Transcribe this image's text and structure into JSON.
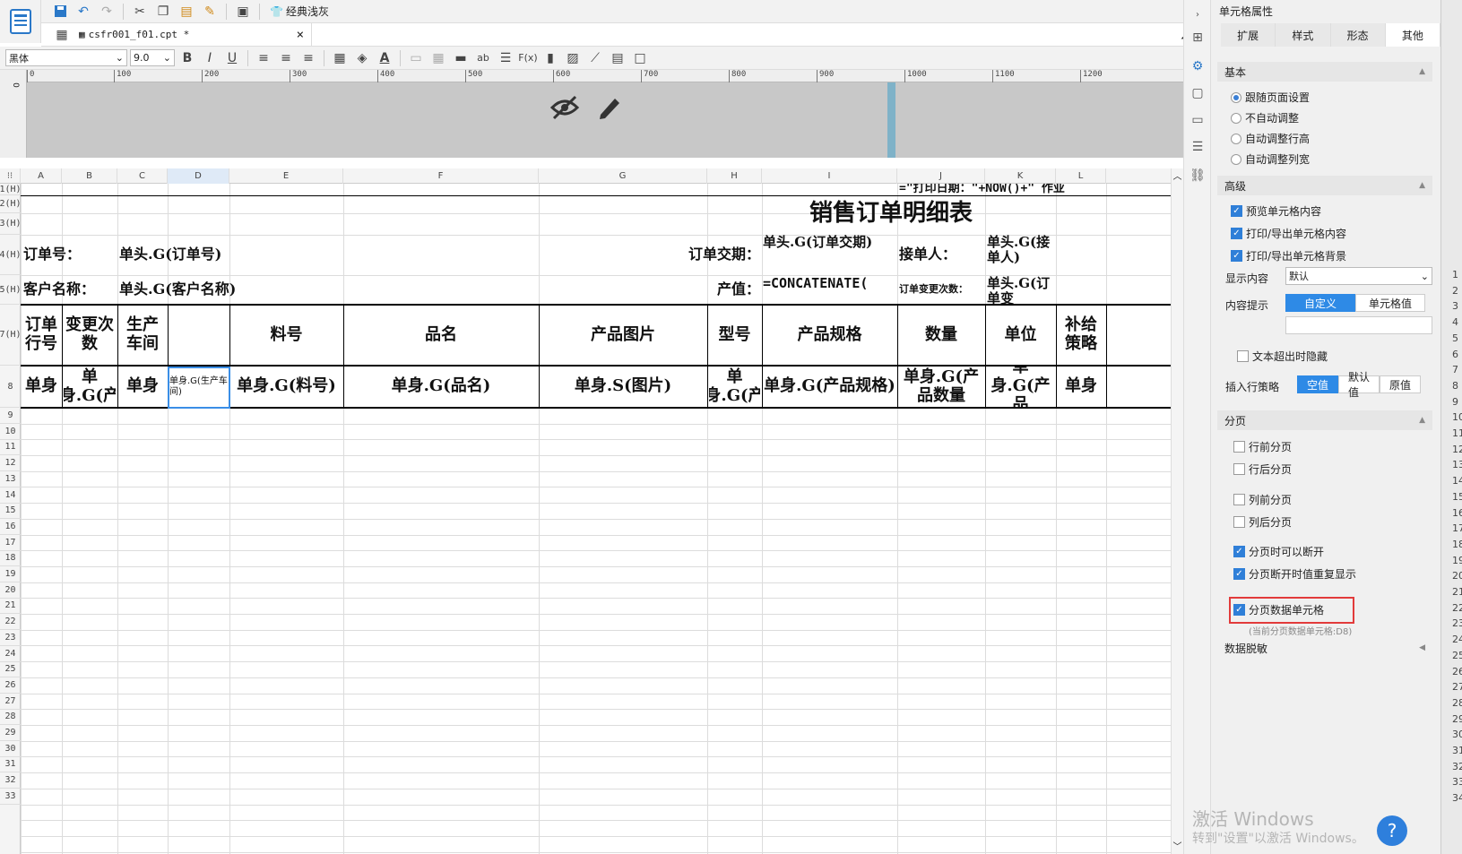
{
  "toolbar": {
    "classic_label": "经典浅灰"
  },
  "tab": {
    "file_name": "csfr001_f01.cpt *",
    "close": "×"
  },
  "format": {
    "font_name": "黑体",
    "font_size": "9.0",
    "bold": "B",
    "italic": "I",
    "underline": "U",
    "ab": "ab",
    "fx": "F(x)"
  },
  "ruler": {
    "ticks": [
      "100",
      "200",
      "300",
      "400",
      "500",
      "600",
      "700",
      "800",
      "900",
      "1000",
      "1100",
      "1200"
    ]
  },
  "columns": [
    "A",
    "B",
    "C",
    "D",
    "E",
    "F",
    "G",
    "H",
    "I",
    "J",
    "K",
    "L"
  ],
  "rows": [
    "1(H)",
    "2(H)",
    "3(H)",
    "4(H)",
    "5(H)",
    "7(H)",
    "8",
    "9",
    "10",
    "11",
    "12",
    "13",
    "14",
    "15",
    "16",
    "17",
    "18",
    "19",
    "20",
    "21",
    "22",
    "23",
    "24",
    "25",
    "26",
    "27",
    "28",
    "29",
    "30",
    "31",
    "32",
    "33"
  ],
  "sheet": {
    "r1": "=\"打印日期：\"+NOW()+\"  作业",
    "title": "销售订单明细表",
    "order_no_label": "订单号：",
    "order_no_val": "单头.G(订单号)",
    "deliv_label": "订单交期：",
    "deliv_val": "单头.G(订单交期)",
    "receiver_label": "接单人：",
    "receiver_val": "单头.G(接单人)",
    "cust_label": "客户名称：",
    "cust_val": "单头.G(客户名称)",
    "value_label": "产值：",
    "value_val": "=CONCATENATE(",
    "change_label": "订单变更次数：",
    "change_val": "单头.G(订单变",
    "headers": [
      "订单行号",
      "变更次数",
      "生产车间",
      "",
      "料号",
      "品名",
      "产品图片",
      "型号",
      "产品规格",
      "数量",
      "单位",
      "补给策略"
    ],
    "row8": [
      "单身",
      "单身.G(产",
      "单身",
      "单身.G(生产车间)",
      "单身.G(料号)",
      "单身.G(品名)",
      "单身.S(图片)",
      "单身.G(产",
      "单身.G(产品规格)",
      "单身.G(产品数量",
      "单身.G(产品",
      "单身"
    ]
  },
  "panel": {
    "title": "单元格属性",
    "tabs": [
      "扩展",
      "样式",
      "形态",
      "其他"
    ],
    "basic": "基本",
    "basic_opts": [
      "跟随页面设置",
      "不自动调整",
      "自动调整行高",
      "自动调整列宽"
    ],
    "advanced": "高级",
    "adv_opts": [
      "预览单元格内容",
      "打印/导出单元格内容",
      "打印/导出单元格背景"
    ],
    "display_label": "显示内容",
    "display_val": "默认",
    "tip_label": "内容提示",
    "tip_opts": [
      "自定义",
      "单元格值"
    ],
    "hide_overflow": "文本超出时隐藏",
    "insert_label": "插入行策略",
    "insert_opts": [
      "空值",
      "默认值",
      "原值"
    ],
    "paging": "分页",
    "paging_opts": [
      "行前分页",
      "行后分页",
      "列前分页",
      "列后分页",
      "分页时可以断开",
      "分页断开时值重复显示",
      "分页数据单元格"
    ],
    "current_paging": "(当前分页数据单元格:D8)",
    "masking": "数据脱敏"
  },
  "far_numbers": [
    "1",
    "2",
    "3",
    "4",
    "5",
    "6",
    "7",
    "8",
    "9",
    "10",
    "11",
    "12",
    "13",
    "14",
    "15",
    "16",
    "17",
    "18",
    "19",
    "20",
    "21",
    "22",
    "23",
    "24",
    "25",
    "26",
    "27",
    "28",
    "29",
    "30",
    "31",
    "32",
    "33",
    "34"
  ],
  "watermark": {
    "line1": "激活 Windows",
    "line2": "转到\"设置\"以激活 Windows。"
  },
  "help": "?"
}
